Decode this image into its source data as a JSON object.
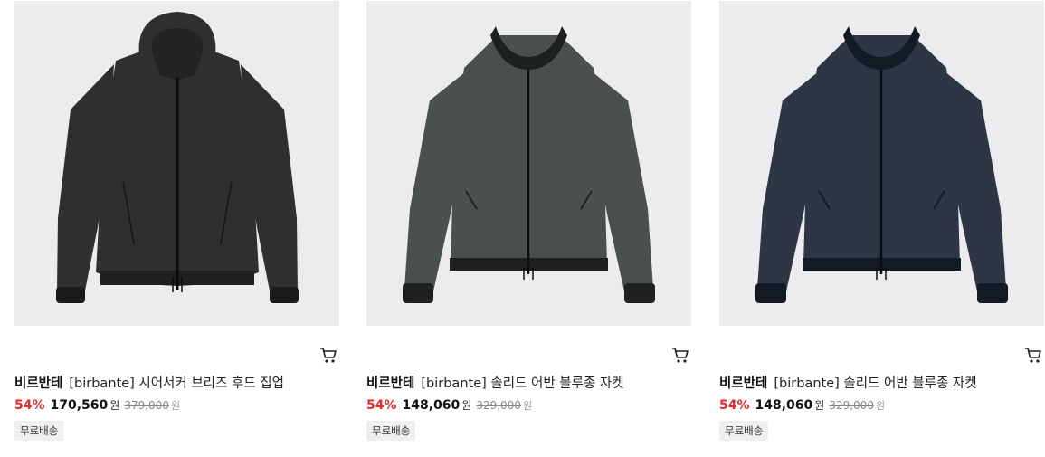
{
  "colors": {
    "discount": "#e32b2b",
    "background": "#ececee"
  },
  "products": [
    {
      "brand": "비르반테",
      "name": "[birbante] 시어서커 브리즈 후드 집업",
      "discount": "54%",
      "price": "170,560",
      "price_unit": "원",
      "original_price": "379,000",
      "original_unit": "원",
      "badge": "무료배송",
      "jacket_color": "#2f2f31",
      "style": "hooded"
    },
    {
      "brand": "비르반테",
      "name": "[birbante] 솔리드 어반 블루종 자켓",
      "discount": "54%",
      "price": "148,060",
      "price_unit": "원",
      "original_price": "329,000",
      "original_unit": "원",
      "badge": "무료배송",
      "jacket_color": "#4a514d",
      "style": "bomber"
    },
    {
      "brand": "비르반테",
      "name": "[birbante] 솔리드 어반 블루종 자켓",
      "discount": "54%",
      "price": "148,060",
      "price_unit": "원",
      "original_price": "329,000",
      "original_unit": "원",
      "badge": "무료배송",
      "jacket_color": "#2e3646",
      "style": "bomber"
    }
  ]
}
